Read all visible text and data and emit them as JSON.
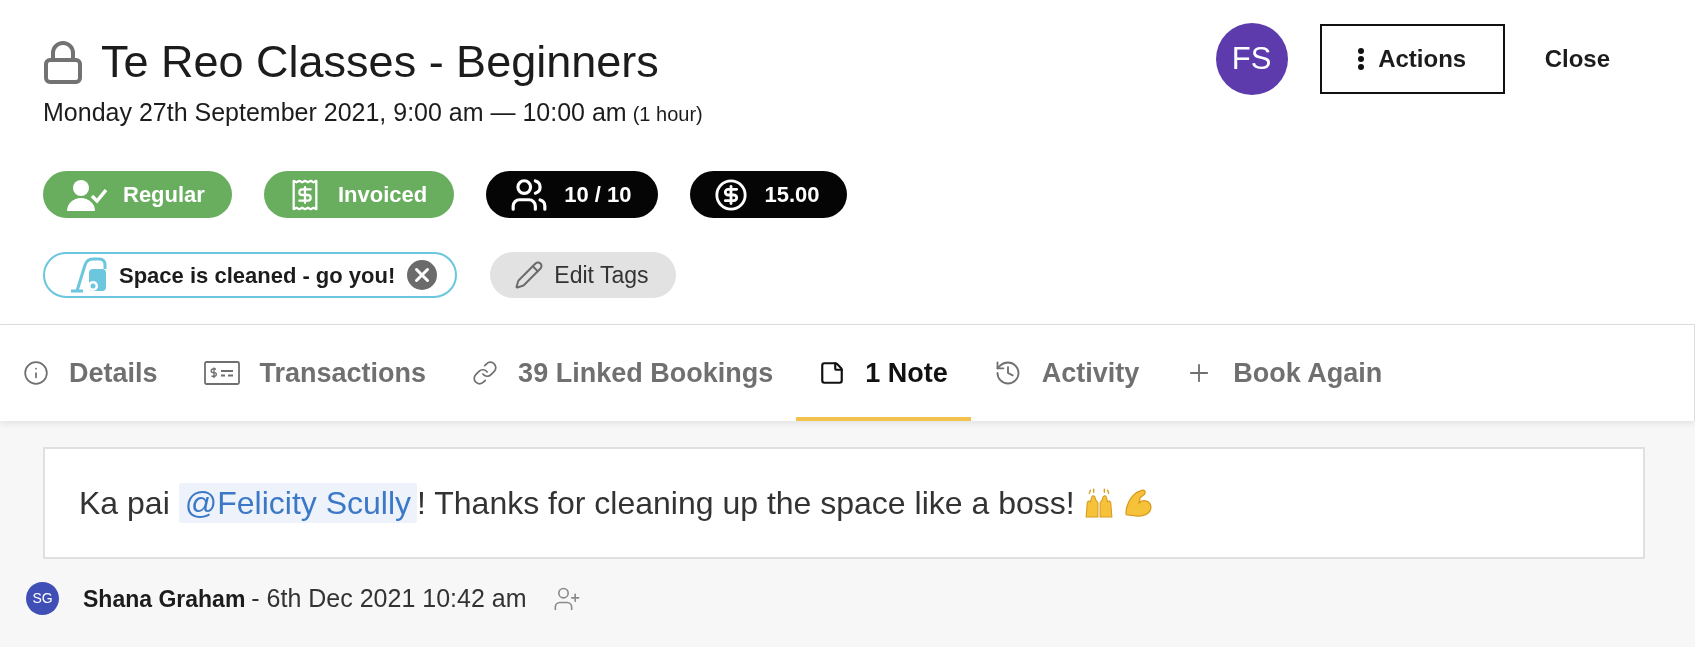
{
  "header": {
    "title": "Te Reo Classes - Beginners",
    "date_time": "Monday 27th September 2021, 9:00 am — 10:00 am",
    "duration": "(1 hour)"
  },
  "user_avatar": {
    "initials": "FS"
  },
  "header_actions": [
    {
      "kind": "menu",
      "label": "Actions"
    },
    {
      "kind": "link",
      "label": "Close"
    }
  ],
  "badges": [
    {
      "kind": "regular",
      "label": "Regular"
    },
    {
      "kind": "invoiced",
      "label": "Invoiced"
    },
    {
      "kind": "capacity",
      "label": "10 / 10"
    },
    {
      "kind": "price",
      "label": "15.00"
    }
  ],
  "tags": [
    {
      "label": "Space is cleaned - go you!"
    }
  ],
  "edit_tags": {
    "label": "Edit Tags"
  },
  "tabs": [
    {
      "kind": "details",
      "label": "Details",
      "selected": false
    },
    {
      "kind": "transactions",
      "label": "Transactions",
      "selected": false
    },
    {
      "kind": "links",
      "label": "39 Linked Bookings",
      "selected": false
    },
    {
      "kind": "notes",
      "label": "1 Note",
      "selected": true
    },
    {
      "kind": "activity",
      "label": "Activity",
      "selected": false
    },
    {
      "kind": "add",
      "label": "Book Again",
      "selected": false
    }
  ],
  "note": {
    "text_before": "Ka pai",
    "mention": "@Felicity Scully",
    "text_after": "! Thanks for cleaning up the space like a boss!",
    "author": {
      "initials": "SG",
      "name": "Shana Graham",
      "timestamp": "- 6th Dec 2021 10:42 am"
    }
  }
}
